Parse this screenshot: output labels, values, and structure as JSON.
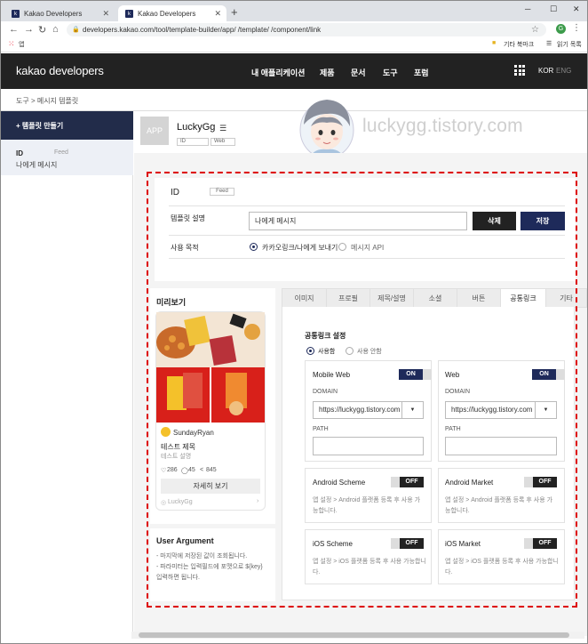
{
  "browser": {
    "tabs": [
      {
        "label": "Kakao Developers"
      },
      {
        "label": "Kakao Developers"
      }
    ],
    "new_tab": "+",
    "url": "developers.kakao.com/tool/template-builder/app/            /template/            /component/link",
    "bookmarks": {
      "apps": "앱",
      "other": "기타 북마크",
      "reading": "읽기 목록"
    },
    "profile_initial": "G"
  },
  "site": {
    "logo": "kakao developers",
    "menu": [
      "내 애플리케이션",
      "제품",
      "문서",
      "도구",
      "포럼"
    ],
    "lang_active": "KOR",
    "lang_inactive": "ENG"
  },
  "breadcrumb": "도구  >  메시지 템플릿",
  "sidebar": {
    "add_button": "+ 템플릿 만들기",
    "item": {
      "id": "ID",
      "type": "Feed",
      "subtitle": "나에게 메시지"
    }
  },
  "app": {
    "thumb": "APP",
    "name": "LuckyGg",
    "id_pill": "ID",
    "web_pill": "Web"
  },
  "watermark": "luckygg.tistory.com",
  "template": {
    "id_label": "ID",
    "type_pill": "Feed",
    "desc_label": "템플릿 설명",
    "desc_value": "나에게 메시지",
    "delete_btn": "삭제",
    "save_btn": "저장",
    "purpose_label": "사용 목적",
    "purpose_opt1": "카카오링크/나에게 보내기",
    "purpose_opt2": "메시지 API"
  },
  "preview": {
    "title": "미리보기",
    "user": "SundayRyan",
    "item_title": "테스트 제목",
    "item_desc": "테스트 설명",
    "likes": "286",
    "comments": "45",
    "shares": "845",
    "detail_btn": "자세히 보기",
    "footer": "LuckyGg"
  },
  "user_argument": {
    "title": "User Argument",
    "line1": "- 마지막에 저장된 값이 조회됩니다.",
    "line2": "- 파라미터는 입력필드에 포맷으로 ${key}",
    "line3": "입력하면 됩니다."
  },
  "tabs": [
    "이미지",
    "프로필",
    "제목/설명",
    "소셜",
    "버튼",
    "공통링크",
    "기타"
  ],
  "common_link": {
    "title": "공통링크 설정",
    "use": "사용함",
    "not_use": "사용 안함",
    "mobile_web": {
      "title": "Mobile Web",
      "toggle": "ON",
      "domain_label": "DOMAIN",
      "domain": "https://luckygg.tistory.com",
      "path_label": "PATH"
    },
    "web": {
      "title": "Web",
      "toggle": "ON",
      "domain_label": "DOMAIN",
      "domain": "https://luckygg.tistory.com",
      "path_label": "PATH"
    },
    "android_scheme": {
      "title": "Android Scheme",
      "toggle": "OFF",
      "l1": "앱 설정 > Android 플랫폼 등록 후 사용 가",
      "l2": "능합니다."
    },
    "android_market": {
      "title": "Android Market",
      "toggle": "OFF",
      "l1": "앱 설정 > Android 플랫폼 등록 후 사용 가",
      "l2": "능합니다."
    },
    "ios_scheme": {
      "title": "iOS Scheme",
      "toggle": "OFF",
      "l1": "앱 설정 > iOS 플랫폼 등록 후 사용 가능합니",
      "l2": "다."
    },
    "ios_market": {
      "title": "iOS Market",
      "toggle": "OFF",
      "l1": "앱 설정 > iOS 플랫폼 등록 후 사용 가능합니",
      "l2": "다."
    }
  },
  "colors": {
    "brand_navy": "#1e2a5a",
    "header_bg": "#222222",
    "highlight_red": "#dd0000"
  }
}
